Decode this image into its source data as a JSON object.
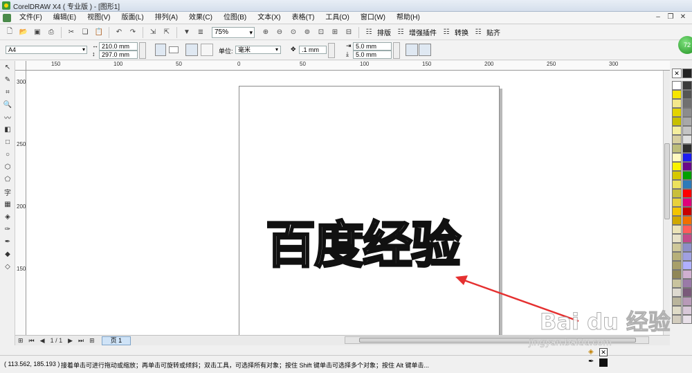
{
  "window": {
    "title": "CorelDRAW X4 ( 专业版 ) - [图形1]"
  },
  "menu": [
    "文件(F)",
    "编辑(E)",
    "视图(V)",
    "版面(L)",
    "排列(A)",
    "效果(C)",
    "位图(B)",
    "文本(X)",
    "表格(T)",
    "工具(O)",
    "窗口(W)",
    "帮助(H)"
  ],
  "toolbar": {
    "zoom_value": "75%",
    "btn_layout": "排版",
    "btn_plugin": "增强插件",
    "btn_convert": "转换",
    "btn_paste": "贴齐"
  },
  "property_bar": {
    "paper_size": "A4",
    "width": "210.0 mm",
    "height": "297.0 mm",
    "unit_label": "单位:",
    "unit_value": "毫米",
    "nudge": ".1 mm",
    "dup_x": "5.0 mm",
    "dup_y": "5.0 mm"
  },
  "rulers": {
    "horizontal": [
      "150",
      "100",
      "50",
      "0",
      "50",
      "100",
      "150",
      "200",
      "250",
      "300"
    ],
    "vertical": [
      "300",
      "250",
      "200",
      "150"
    ]
  },
  "canvas": {
    "text": "百度经验"
  },
  "pages": {
    "indicator": "1 / 1",
    "tab": "页 1"
  },
  "status": {
    "coords": "( 113.562, 185.193 )",
    "message": "接着单击可进行拖动或缩放；再单击可旋转或倾斜；双击工具，可选择所有对象；按住 Shift 键单击可选择多个对象；按住 Alt 键单击..."
  },
  "watermark": {
    "logo": "Bai du 经验",
    "url": "jingyan.baidu.com"
  },
  "palette_colors_left": [
    "#ffffff",
    "#f7e600",
    "#f4e88c",
    "#e3d400",
    "#c8c000",
    "#f5ef9e",
    "#d8d0a0",
    "#bdbd7a",
    "#fff9c0",
    "#f9f300",
    "#d6c800",
    "#ede25c",
    "#c9bf3c",
    "#e8d13c",
    "#f3c400",
    "#d0a800",
    "#ece4b8",
    "#e8e2c8",
    "#cfc89a",
    "#b7b07a",
    "#a89f6a",
    "#908758",
    "#c9c49e",
    "#dedad0",
    "#bab59c",
    "#e0dcc8",
    "#d3cdbe"
  ],
  "palette_colors_right": [
    "#3a3a3a",
    "#555555",
    "#707070",
    "#8c8c8c",
    "#a8a8a8",
    "#c4c4c4",
    "#e0e0e0",
    "#2f2f2f",
    "#1c1cf0",
    "#6a0a8a",
    "#00a000",
    "#2d7ab8",
    "#ff0000",
    "#e0007a",
    "#c80000",
    "#f07000",
    "#ff5c5c",
    "#c24a8a",
    "#8e8ec8",
    "#a0a0e0",
    "#b0b0ff",
    "#d0b0d0",
    "#9a7aa8",
    "#7a5a7a",
    "#b89ab8",
    "#d8c8d8",
    "#e8e0e8"
  ]
}
